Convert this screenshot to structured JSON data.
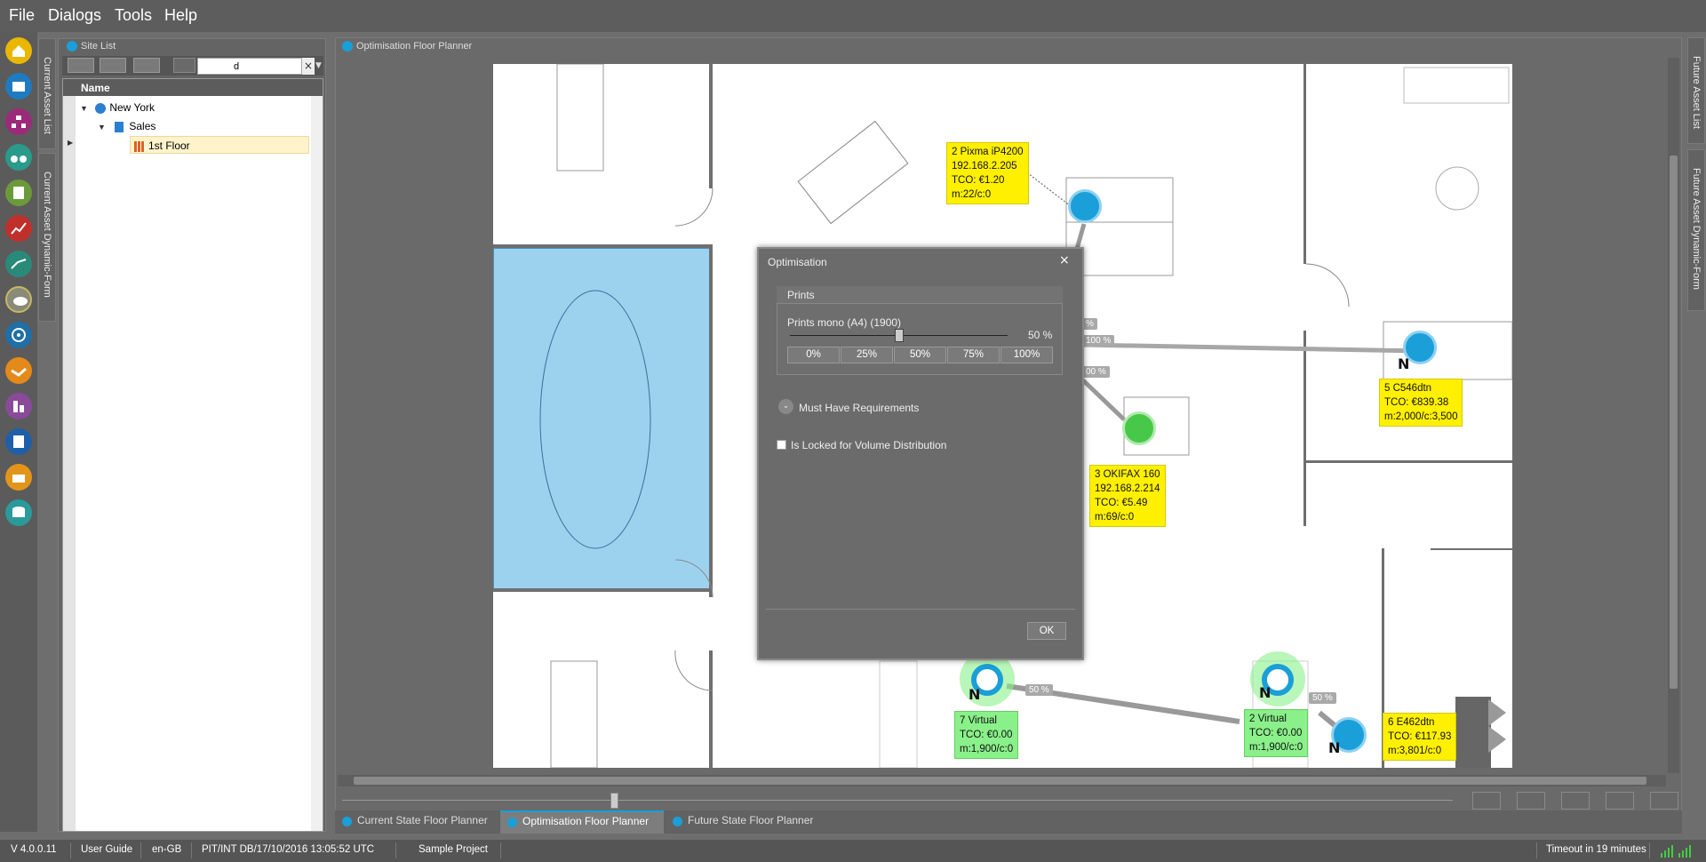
{
  "menu": [
    "File",
    "Dialogs",
    "Tools",
    "Help"
  ],
  "side_tabs": {
    "current_asset_list": "Current Asset List",
    "current_asset_dynamic_form": "Current Asset Dynamic-Form",
    "future_asset_list": "Future Asset List",
    "future_asset_dynamic_form": "Future Asset Dynamic-Form"
  },
  "site_list": {
    "title": "Site List",
    "search_value": "d",
    "column_name": "Name",
    "tree": [
      {
        "label": "New York",
        "level": 0
      },
      {
        "label": "Sales",
        "level": 1
      },
      {
        "label": "1st Floor",
        "level": 2
      }
    ]
  },
  "main_title": "Optimisation Floor Planner",
  "devices": {
    "pixma": [
      "2 Pixma iP4200",
      "192.168.2.205",
      "TCO: €1.20",
      "m:22/c:0"
    ],
    "c546": [
      "5 C546dtn",
      "TCO: €839.38",
      "m:2,000/c:3,500"
    ],
    "okifax": [
      "3 OKIFAX 160",
      "192.168.2.214",
      "TCO: €5.49",
      "m:69/c:0"
    ],
    "virtual7": [
      "7 Virtual",
      "TCO: €0.00",
      "m:1,900/c:0"
    ],
    "virtual2": [
      "2 Virtual",
      "TCO: €0.00",
      "m:1,900/c:0"
    ],
    "e462": [
      "6 E462dtn",
      "TCO: €117.93",
      "m:3,801/c:0"
    ]
  },
  "percent_labels": {
    "p1": "%",
    "p2": "100 %",
    "p3": "00 %",
    "p4": "50 %",
    "p5": "50 %"
  },
  "n_label": "N",
  "dialog": {
    "title": "Optimisation",
    "section": "Prints",
    "slider_label": "Prints mono (A4) (1900)",
    "slider_value": "50 %",
    "slider_fraction": 0.5,
    "presets": [
      "0%",
      "25%",
      "50%",
      "75%",
      "100%"
    ],
    "must_have": "Must Have Requirements",
    "locked_label": "Is Locked for Volume Distribution",
    "ok": "OK"
  },
  "bottom_tabs": [
    "Current State Floor Planner",
    "Optimisation Floor Planner",
    "Future State Floor Planner"
  ],
  "status": {
    "version": "V 4.0.0.11",
    "guide": "User Guide",
    "locale": "en-GB",
    "db": "PIT/INT DB/17/10/2016 13:05:52 UTC",
    "project": "Sample Project",
    "timeout": "Timeout in 19 minutes"
  },
  "colors": {
    "accent": "#1a9fd8",
    "tooltip": "#fff000",
    "virtual": "#8af08a",
    "room_highlight": "#9dd2ef"
  }
}
